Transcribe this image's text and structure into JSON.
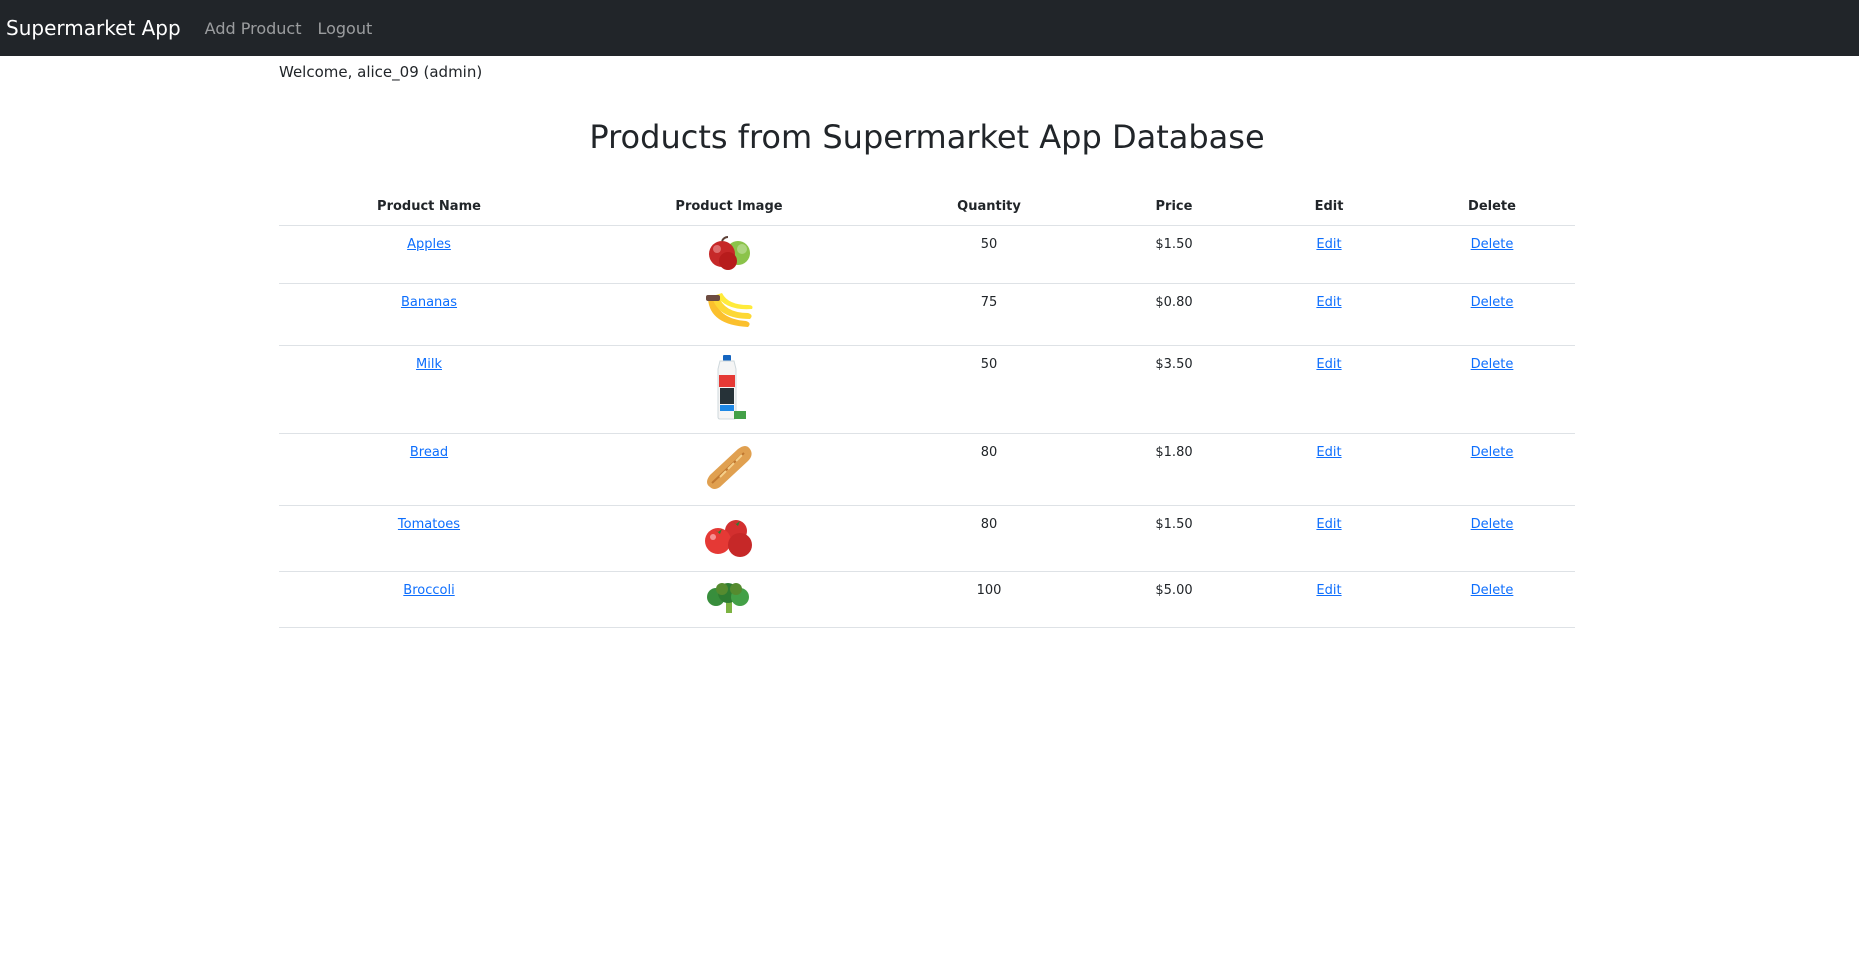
{
  "nav": {
    "brand": "Supermarket App",
    "links": [
      "Add Product",
      "Logout"
    ]
  },
  "welcome": "Welcome, alice_09 (admin)",
  "page_title": "Products from Supermarket App Database",
  "table": {
    "headers": [
      "Product Name",
      "Product Image",
      "Quantity",
      "Price",
      "Edit",
      "Delete"
    ],
    "rows": [
      {
        "name": "Apples",
        "image": "apples-image",
        "quantity": "50",
        "price": "$1.50",
        "edit": "Edit",
        "delete": "Delete"
      },
      {
        "name": "Bananas",
        "image": "bananas-image",
        "quantity": "75",
        "price": "$0.80",
        "edit": "Edit",
        "delete": "Delete"
      },
      {
        "name": "Milk",
        "image": "milk-image",
        "quantity": "50",
        "price": "$3.50",
        "edit": "Edit",
        "delete": "Delete"
      },
      {
        "name": "Bread",
        "image": "bread-image",
        "quantity": "80",
        "price": "$1.80",
        "edit": "Edit",
        "delete": "Delete"
      },
      {
        "name": "Tomatoes",
        "image": "tomatoes-image",
        "quantity": "80",
        "price": "$1.50",
        "edit": "Edit",
        "delete": "Delete"
      },
      {
        "name": "Broccoli",
        "image": "broccoli-image",
        "quantity": "100",
        "price": "$5.00",
        "edit": "Edit",
        "delete": "Delete"
      }
    ]
  },
  "colors": {
    "navbar_bg": "#212529",
    "link": "#0d6efd",
    "border": "#dee2e6"
  }
}
